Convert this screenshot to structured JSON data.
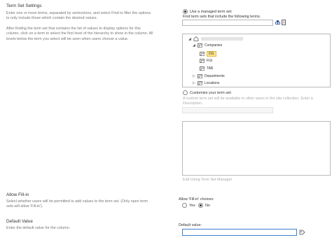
{
  "left": {
    "term_set": {
      "title": "Term Set Settings",
      "desc1": "Enter one or more terms, separated by semicolons, and select Find to filter the options to only include those which contain the desired values.",
      "desc2": "After finding the term set that contains the list of values to display options for this column, click on a term to select the first level of the hierarchy to show in the column. All levels below the term you select will be seen when users choose a value."
    },
    "allow_fill": {
      "title": "Allow Fill-in",
      "desc": "Select whether users will be permitted to add values to the term set. (Only open term sets will allow 'Fill-in')."
    },
    "default_value": {
      "title": "Default Value",
      "desc": "Enter the default value for the column."
    }
  },
  "right": {
    "managed": {
      "radio_label": "Use a managed term set:",
      "find_label": "Find term sets that include the following terms.",
      "search_value": ""
    },
    "tree": {
      "root": "",
      "nodes": [
        "Companies",
        "DG",
        "FGI",
        "TAB",
        "Departments",
        "Locations"
      ]
    },
    "custom": {
      "radio_label": "Customize your term set:",
      "desc": "A custom term set will be available to other users in the site collection. Enter a Description.",
      "link": "Edit Using Term Set Manager"
    },
    "fill_in": {
      "label": "Allow 'Fill-in' choices:",
      "yes": "Yes",
      "no": "No",
      "selected": "No"
    },
    "default_value": {
      "label": "Default value:",
      "value": ""
    }
  },
  "colors": {
    "highlight": "#ffe58a",
    "border": "#b9b9b9",
    "text": "#333333"
  },
  "icons": [
    "find-icon",
    "browse-icon",
    "store-icon",
    "term-icon",
    "expand-icon",
    "collapse-icon",
    "pick-tag-icon"
  ]
}
